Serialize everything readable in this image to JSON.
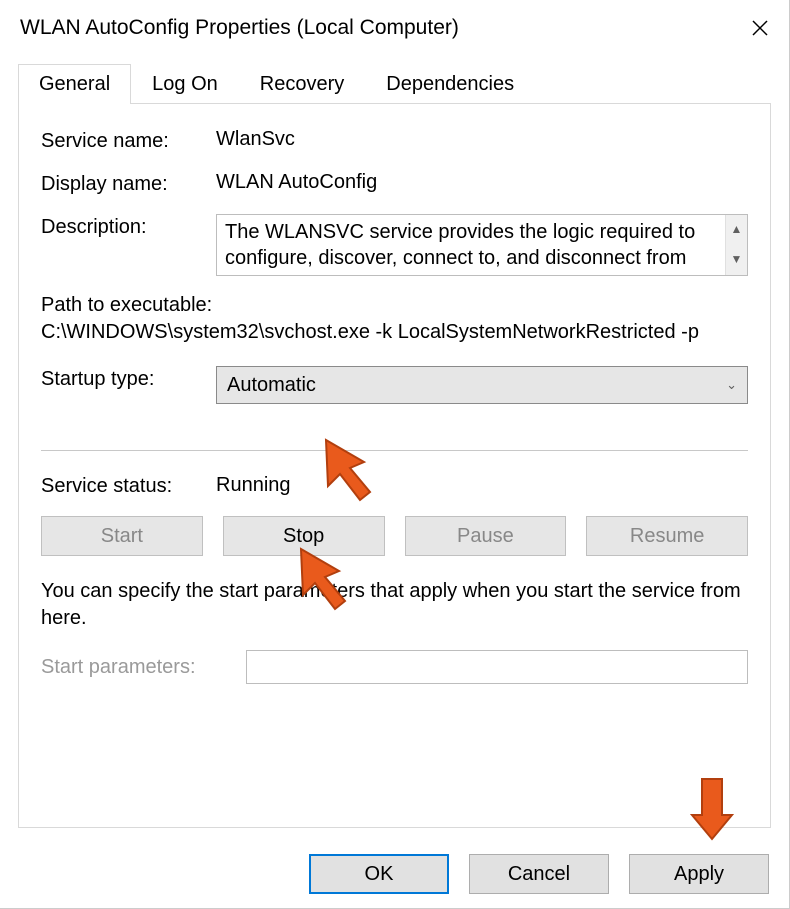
{
  "window": {
    "title": "WLAN AutoConfig Properties (Local Computer)"
  },
  "tabs": {
    "general": "General",
    "logon": "Log On",
    "recovery": "Recovery",
    "dependencies": "Dependencies"
  },
  "general": {
    "service_name_label": "Service name:",
    "service_name": "WlanSvc",
    "display_name_label": "Display name:",
    "display_name": "WLAN AutoConfig",
    "description_label": "Description:",
    "description": "The WLANSVC service provides the logic required to configure, discover, connect to, and disconnect from",
    "path_label": "Path to executable:",
    "path_value": "C:\\WINDOWS\\system32\\svchost.exe -k LocalSystemNetworkRestricted -p",
    "startup_type_label": "Startup type:",
    "startup_type": "Automatic",
    "service_status_label": "Service status:",
    "service_status": "Running",
    "buttons": {
      "start": "Start",
      "stop": "Stop",
      "pause": "Pause",
      "resume": "Resume"
    },
    "hint": "You can specify the start parameters that apply when you start the service from here.",
    "start_params_label": "Start parameters:",
    "start_params_value": ""
  },
  "footer": {
    "ok": "OK",
    "cancel": "Cancel",
    "apply": "Apply"
  }
}
